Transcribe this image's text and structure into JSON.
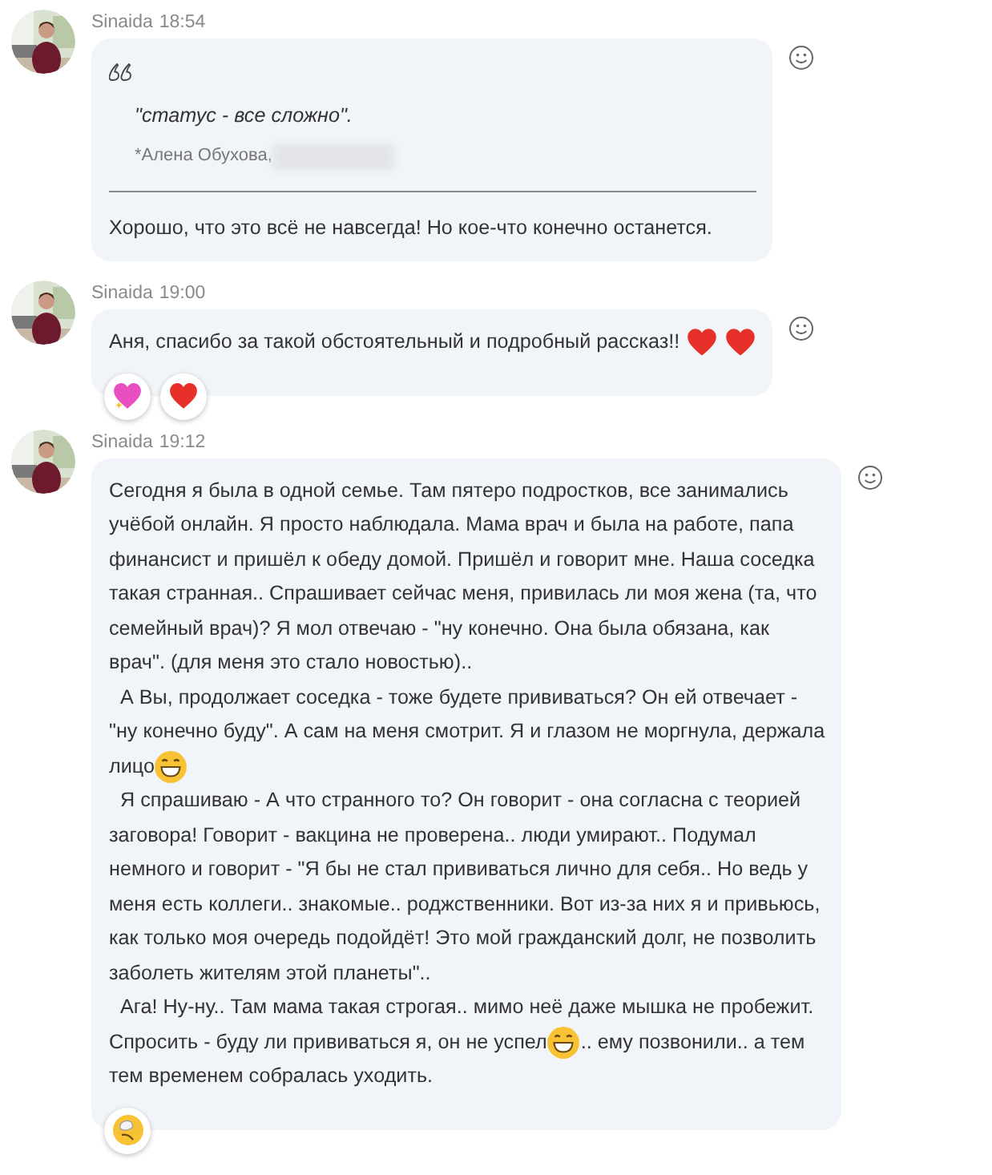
{
  "messages": [
    {
      "author": "Sinaida",
      "time": "18:54",
      "quote": {
        "text": "\"статус - все сложно\".",
        "source": "*Алена Обухова,",
        "source_redacted": true
      },
      "body": [
        [
          {
            "kind": "text",
            "text": "Хорошо, что это всё не навсегда! Но кое-что конечно останется."
          }
        ]
      ]
    },
    {
      "author": "Sinaida",
      "time": "19:00",
      "body": [
        [
          {
            "kind": "text",
            "text": "Аня, спасибо за такой обстоятельный и подробный рассказ!!"
          },
          {
            "kind": "heart"
          },
          {
            "kind": "heart"
          }
        ]
      ],
      "reactions": [
        {
          "kind": "sparkle-heart"
        },
        {
          "kind": "heart"
        }
      ]
    },
    {
      "author": "Sinaida",
      "time": "19:12",
      "body": [
        [
          {
            "kind": "text",
            "text": "Сегодня я была в одной семье. Там пятеро подростков, все занимались"
          }
        ],
        [
          {
            "kind": "text",
            "text": "учёбой онлайн. Я просто наблюдала. Мама врач и была на работе, папа"
          }
        ],
        [
          {
            "kind": "text",
            "text": "финансист и пришёл к обеду домой. Пришёл и говорит мне. Наша соседка"
          }
        ],
        [
          {
            "kind": "text",
            "text": "такая странная.. Спрашивает сейчас меня, привилась ли моя жена (та, что"
          }
        ],
        [
          {
            "kind": "text",
            "text": "семейный врач)? Я мол отвечаю - \"ну конечно. Она была обязана, как"
          }
        ],
        [
          {
            "kind": "text",
            "text": "врач\". (для меня это стало новостью).."
          }
        ],
        [
          {
            "kind": "text",
            "text": "  А Вы, продолжает соседка - тоже будете прививаться? Он ей отвечает -"
          }
        ],
        [
          {
            "kind": "text",
            "text": "\"ну конечно буду\". А сам на меня смотрит. Я и глазом не моргнула, держала"
          }
        ],
        [
          {
            "kind": "text",
            "text": "лицо"
          },
          {
            "kind": "grin"
          }
        ],
        [
          {
            "kind": "text",
            "text": "  Я спрашиваю - А что странного то? Он говорит - она согласна с теорией"
          }
        ],
        [
          {
            "kind": "text",
            "text": "заговора! Говорит - вакцина не проверена.. люди умирают.. Подумал"
          }
        ],
        [
          {
            "kind": "text",
            "text": "немного и говорит - \"Я бы не стал прививаться лично для себя.. Но ведь у"
          }
        ],
        [
          {
            "kind": "text",
            "text": "меня есть коллеги.. знакомые.. роджственники. Вот из-за них я и привьюсь,"
          }
        ],
        [
          {
            "kind": "text",
            "text": "как только моя очередь подойдёт! Это мой гражданский долг, не позволить"
          }
        ],
        [
          {
            "kind": "text",
            "text": "заболеть жителям этой планеты\".."
          }
        ],
        [
          {
            "kind": "text",
            "text": "  Ага! Ну-ну.. Там мама такая строгая.. мимо неё даже мышка не пробежит."
          }
        ],
        [
          {
            "kind": "text",
            "text": "Спросить - буду ли прививаться я, он не успел"
          },
          {
            "kind": "grin"
          },
          {
            "kind": "text",
            "text": ".. ему позвонили.. а тем"
          }
        ],
        [
          {
            "kind": "text",
            "text": "тем временем собралась уходить."
          }
        ]
      ],
      "reactions": [
        {
          "kind": "thinking"
        }
      ]
    }
  ]
}
